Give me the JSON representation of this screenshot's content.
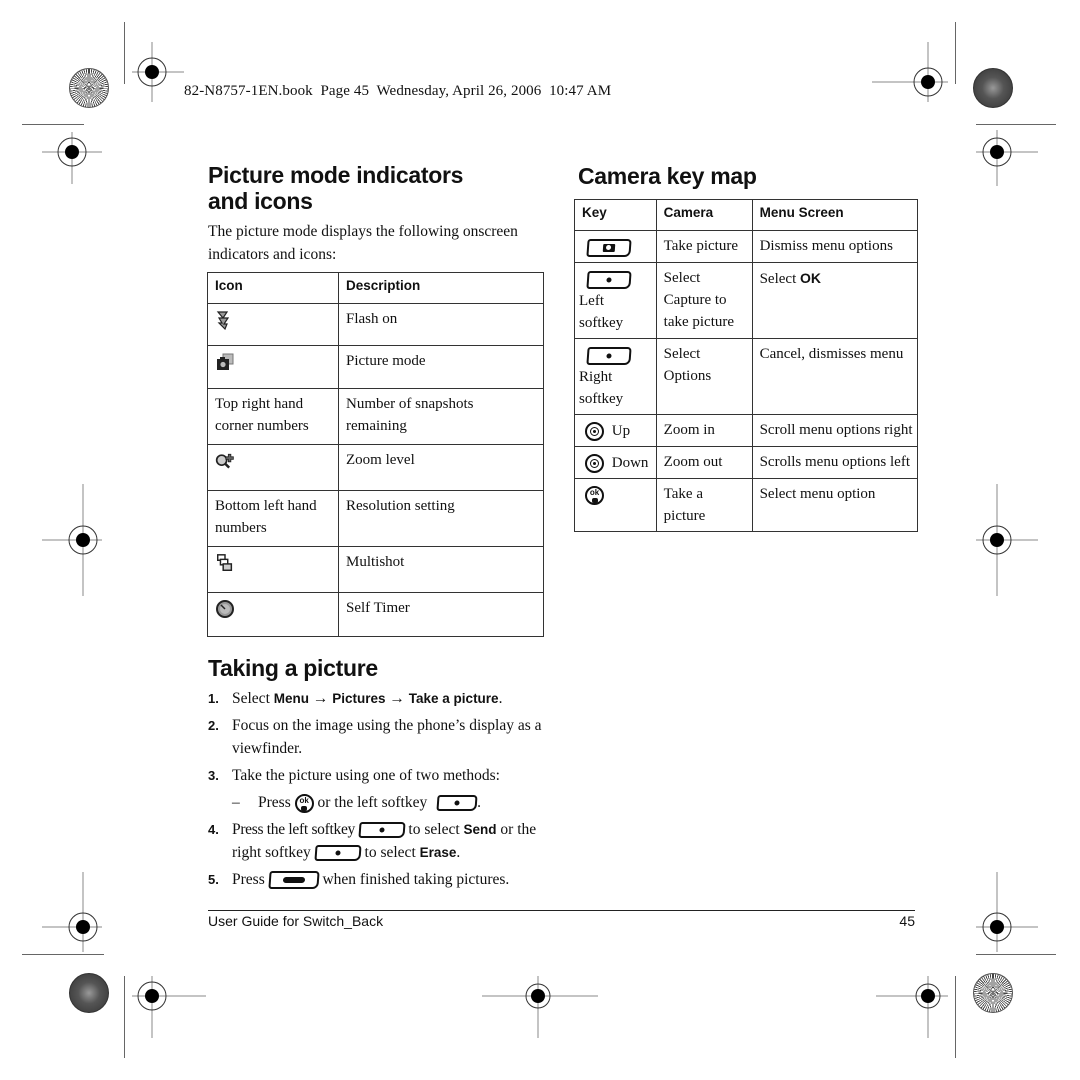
{
  "print_header": "82-N8757-1EN.book  Page 45  Wednesday, April 26, 2006  10:47 AM",
  "picture_mode": {
    "title_line1": "Picture mode indicators",
    "title_line2": "and icons",
    "intro": "The picture mode displays the following onscreen indicators and icons:",
    "table": {
      "headers": [
        "Icon",
        "Description"
      ],
      "rows": [
        {
          "icon": "flash-icon",
          "icon_text": "",
          "description": "Flash on"
        },
        {
          "icon": "picture-mode-icon",
          "icon_text": "",
          "description": "Picture mode"
        },
        {
          "icon": "",
          "icon_text": "Top right hand corner numbers",
          "description": "Number of snapshots remaining"
        },
        {
          "icon": "zoom-level-icon",
          "icon_text": "",
          "description": "Zoom level"
        },
        {
          "icon": "",
          "icon_text": "Bottom left hand numbers",
          "description": "Resolution setting"
        },
        {
          "icon": "multishot-icon",
          "icon_text": "",
          "description": "Multishot"
        },
        {
          "icon": "self-timer-icon",
          "icon_text": "",
          "description": "Self Timer"
        }
      ]
    }
  },
  "key_map": {
    "title": "Camera key map",
    "headers": [
      "Key",
      "Camera",
      "Menu Screen"
    ],
    "rows": [
      {
        "key_icon": "camera-key-icon",
        "key_label": "",
        "camera": "Take picture",
        "menu_screen": "Dismiss menu options",
        "menu_bold": ""
      },
      {
        "key_icon": "left-softkey-icon",
        "key_label": "Left softkey",
        "camera": "Select Capture to take picture",
        "menu_screen": "Select ",
        "menu_bold": "OK"
      },
      {
        "key_icon": "right-softkey-icon",
        "key_label": "Right softkey",
        "camera": "Select Options",
        "menu_screen": "Cancel, dismisses menu",
        "menu_bold": ""
      },
      {
        "key_icon": "nav-key-icon",
        "key_label": "Up",
        "camera": "Zoom in",
        "menu_screen": "Scroll menu options right",
        "menu_bold": ""
      },
      {
        "key_icon": "nav-key-icon",
        "key_label": "Down",
        "camera": "Zoom out",
        "menu_screen": "Scrolls menu options left",
        "menu_bold": ""
      },
      {
        "key_icon": "ok-key-icon",
        "key_label": "",
        "camera": "Take a picture",
        "menu_screen": "Select menu option",
        "menu_bold": ""
      }
    ]
  },
  "taking_picture": {
    "title": "Taking a picture",
    "steps": [
      {
        "num": "1.",
        "parts": [
          "Select ",
          "Menu",
          " → ",
          "Pictures",
          " → ",
          "Take a picture",
          "."
        ]
      },
      {
        "num": "2.",
        "text": "Focus on the image using the phone’s display as a viewfinder."
      },
      {
        "num": "3.",
        "text": "Take the picture using one of two methods:"
      },
      {
        "num": "4.",
        "parts": [
          "Press the left softkey ",
          " to select ",
          "Send",
          " or the right softkey ",
          " to select ",
          "Erase",
          "."
        ]
      },
      {
        "num": "5.",
        "parts": [
          "Press ",
          " when finished taking pictures."
        ]
      }
    ],
    "substep": {
      "dash": "–",
      "parts": [
        "Press ",
        " or the left softkey ",
        "."
      ]
    }
  },
  "footer": {
    "title": "User Guide for Switch_Back",
    "page": "45"
  }
}
